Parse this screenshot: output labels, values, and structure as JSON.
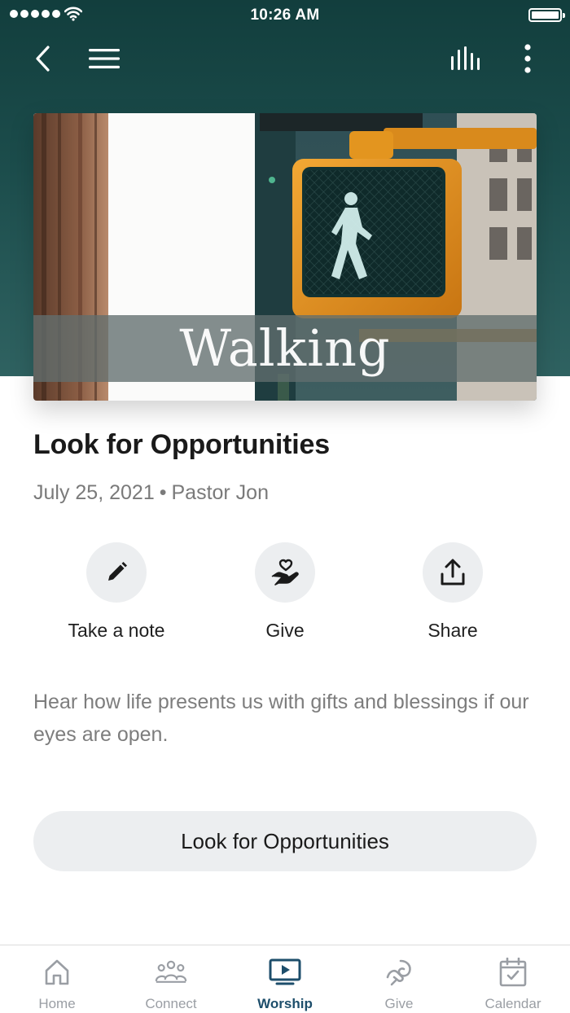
{
  "status_bar": {
    "time": "10:26 AM"
  },
  "hero": {
    "overlay_word": "Walking"
  },
  "sermon": {
    "title": "Look for Opportunities",
    "date": "July 25, 2021",
    "separator": "•",
    "speaker": "Pastor Jon",
    "description": "Hear how life presents us with gifts and blessings if our eyes are open."
  },
  "actions": [
    {
      "label": "Take a note",
      "icon": "pencil-icon"
    },
    {
      "label": "Give",
      "icon": "heart-hand-icon"
    },
    {
      "label": "Share",
      "icon": "share-icon"
    }
  ],
  "cta": {
    "label": "Look for Opportunities"
  },
  "tabbar": {
    "tabs": [
      {
        "label": "Home",
        "icon": "home-icon",
        "active": false
      },
      {
        "label": "Connect",
        "icon": "people-icon",
        "active": false
      },
      {
        "label": "Worship",
        "icon": "tv-play-icon",
        "active": true
      },
      {
        "label": "Give",
        "icon": "give-icon",
        "active": false
      },
      {
        "label": "Calendar",
        "icon": "calendar-icon",
        "active": false
      }
    ]
  },
  "colors": {
    "header_dark": "#123e3d",
    "header_light": "#2f6261",
    "active_tab": "#1d4e6b",
    "inactive_tab": "#9a9ea4",
    "button_bg": "#eceef0"
  }
}
